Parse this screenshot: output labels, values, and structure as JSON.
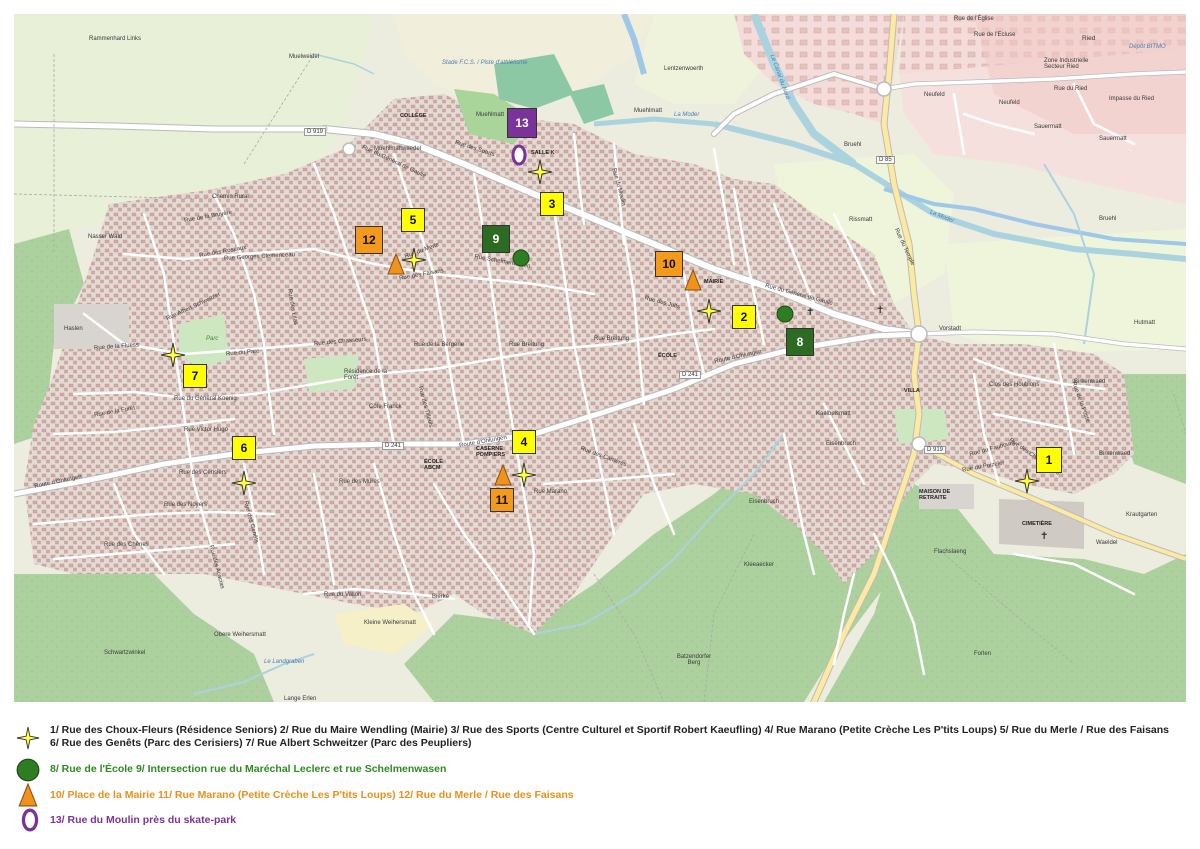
{
  "map": {
    "labels": {
      "rammenhard": "Rammenhard Links",
      "muelweid": "Muelweidel",
      "stade": "Stade F.C.S. / Piste d'athlétisme",
      "muehlmatt_top": "Muehlmatt",
      "lentzenwoerth": "Lentzenwoerth",
      "canal": "Le Canal du Nord",
      "moder1": "La Moder",
      "moder2": "La Moder",
      "rue_eglise": "Rue de l'Église",
      "rue_ecluse": "Rue de l'Ecluse",
      "ried": "Ried",
      "zone_ind": "Zone Industrielle Secteur Ried",
      "depot": "Dépôt BITMO",
      "neufeld1": "Neufeld",
      "neufeld2": "Neufeld",
      "rue_ried": "Rue du Ried",
      "impasse_ried": "Impasse du Ried",
      "sauermatt1": "Sauermatt",
      "sauermatt2": "Sauermatt",
      "bruehl1": "Bruehl",
      "bruehl2": "Bruehl",
      "d85": "D 85",
      "d919": "D 919",
      "d919b": "D 919",
      "d241a": "D 241",
      "d241b": "D 241",
      "college": "COLLÈGE",
      "muehlmattwaedel": "Muehlmattwaedel",
      "muehlmatt2": "Muehlmatt",
      "salle_k": "SALLE K",
      "rissmatt": "Rissmatt",
      "chemin_rural": "Chemin Rural",
      "nasser_wald": "Nasser Wald",
      "haslen": "Haslen",
      "parc": "Parc",
      "mairie": "MAIRIE",
      "ecole": "ÉCOLE",
      "vorstadt": "Vorstadt",
      "hutmatt": "Hutmatt",
      "birkenwaed1": "Birkenwaed",
      "birkenwaed2": "Birkenwaed",
      "villa": "VILLA",
      "kaelbelsmatt": "Kaelbelsmatt",
      "eisenbruch1": "Eisenbruch",
      "eisenbruch2": "Eisenbruch",
      "residence": "Résidence de la Forêt",
      "ecole_abcm": "ÉCOLE ABCM",
      "caserne": "CASERNE POMPIERS",
      "maison_retraite": "MAISON DE RETRAITE",
      "cimetiere": "CIMETIÈRE",
      "krautgarten": "Krautgarten",
      "waeldel": "Waeldel",
      "flachslaeng": "Flachslaeng",
      "kleeaecker": "Kleeaecker",
      "bierke": "Bierke",
      "obere_weihersmatt": "Obere Weihersmatt",
      "kleine_weihersmatt": "Kleine Weihersmatt",
      "schwartzwinkel": "Schwartzwinkel",
      "lange_erlen": "Lange Erlen",
      "batzendorfer": "Batzendorfer Berg",
      "forlen": "Forlen",
      "landgraben": "Le Landgraben",
      "rue_sports": "Rue des Sports",
      "rue_gen_gaulle1": "Rue du Général de Gaulle",
      "rue_gen_gaulle2": "Rue du Général de Gaulle",
      "rue_clemenceau": "Rue Georges Clemenceau",
      "rue_chasseurs": "Rue des Chasseurs",
      "rue_bergerie": "Rue de la Bergerie",
      "rue_breitung1": "Rue Breitung",
      "rue_breitung2": "Rue Breitung",
      "rue_fluess": "Rue de la Fluess",
      "rue_paix": "Rue du Parc",
      "rue_gen_koenig": "Rue du Général Koenig",
      "rue_victor_hugo": "Rue Victor Hugo",
      "route_ohlungen1": "Route d'Ohlungen",
      "route_ohlungen2": "Route d'Ohlungen",
      "route_ohlungen3": "Route d'Ohlungen",
      "rue_cerisiers": "Rue des Cerisiers",
      "rue_noyers": "Rue des Noyers",
      "rue_mures": "Rue des Mûres",
      "rue_chenes": "Rue des Chênes",
      "rue_vallon": "Rue du Vallon",
      "rue_marano": "Rue Marano",
      "rue_carrieres": "Rue des Carrières",
      "rue_faisans": "Rue des Faisans",
      "rue_merle": "Rue du Merle",
      "rue_juifs": "Rue des Juifs",
      "rue_poizeler": "Rue du Poizeler",
      "rue_faubourg": "Rue du Faubourg",
      "rue_choux": "Rue des Choux-Fleurs",
      "rue_houblons": "Clos des Houblons",
      "rue_temple": "Rue du Temple",
      "rue_moulin": "Rue du Moulin",
      "rue_schelmenwasen": "Rue Schelmenwasen",
      "rue_roseaux": "Rue des Roseaux",
      "rue_bruyere": "Rue de la Bruyère",
      "rue_foret": "Rue de la Forêt",
      "rue_tilleuls": "Rue des Tilleuls",
      "cote_franck": "Côte Franck",
      "rue_albert": "Rue Albert Schweitzer",
      "rue_genets": "Rue des Genêts",
      "rue_acacias": "Rue des Acacias",
      "rue_boulevard": "Rue de la Poste",
      "rue_lilas": "Rue des Lilas"
    },
    "markers": [
      {
        "label": "1"
      },
      {
        "label": "2"
      },
      {
        "label": "3"
      },
      {
        "label": "4"
      },
      {
        "label": "5"
      },
      {
        "label": "6"
      },
      {
        "label": "7"
      },
      {
        "label": "8"
      },
      {
        "label": "9"
      },
      {
        "label": "10"
      },
      {
        "label": "11"
      },
      {
        "label": "12"
      },
      {
        "label": "13"
      }
    ]
  },
  "legend": {
    "star_text": "1/ Rue des Choux-Fleurs (Résidence Seniors) 2/ Rue du Maire Wendling (Mairie) 3/ Rue des Sports (Centre Culturel et Sportif Robert Kaeufling) 4/ Rue Marano (Petite Crèche Les P'tits Loups) 5/ Rue du Merle / Rue des Faisans 6/ Rue des Genêts (Parc des Cerisiers) 7/ Rue Albert Schweitzer (Parc des Peupliers)",
    "circle_text": "8/ Rue de l'École 9/ Intersection rue du Maréchal Leclerc et rue Schelmenwasen",
    "triangle_text": "10/ Place de la Mairie 11/ Rue Marano (Petite Crèche Les P'tits Loups) 12/ Rue du Merle / Rue des Faisans",
    "oval_text": "13/ Rue du Moulin près du skate-park"
  },
  "colors": {
    "star": "#ffff44",
    "circle": "#2e7d22",
    "triangle": "#f0921e",
    "oval": "#7a3399",
    "marker_yellow": "#ffff00",
    "marker_orange": "#f39a1d",
    "marker_green": "#2e6b22",
    "marker_purple": "#7a3399",
    "legend_star_text": "#222222",
    "legend_circle_text": "#2e8b22",
    "legend_triangle_text": "#e8901a",
    "legend_oval_text": "#7a3399"
  }
}
